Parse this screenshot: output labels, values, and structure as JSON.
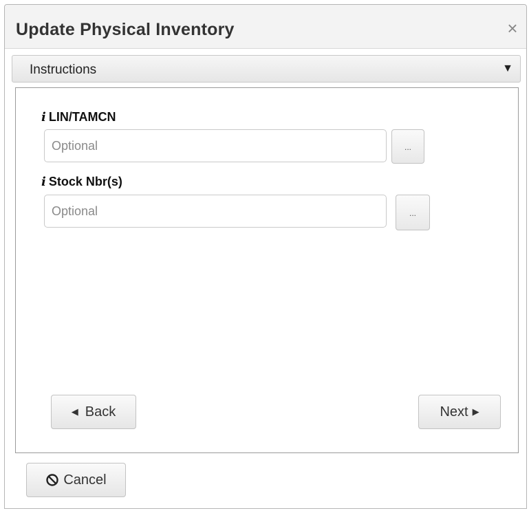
{
  "dialog": {
    "title": "Update Physical Inventory",
    "close_glyph": "×"
  },
  "instructions": {
    "label": "Instructions",
    "toggle_glyph": "▼"
  },
  "fields": {
    "lin": {
      "label": "LIN/TAMCN",
      "placeholder": "Optional",
      "value": "",
      "lookup_label": "..."
    },
    "stock": {
      "label": "Stock Nbr(s)",
      "placeholder": "Optional",
      "value": "",
      "lookup_label": "..."
    },
    "info_glyph": "i"
  },
  "nav": {
    "back_label": "Back",
    "back_glyph": "◀",
    "next_label": "Next",
    "next_glyph": "▶"
  },
  "footer": {
    "cancel_label": "Cancel",
    "cancel_icon": "cancel-circle-slash-icon"
  }
}
